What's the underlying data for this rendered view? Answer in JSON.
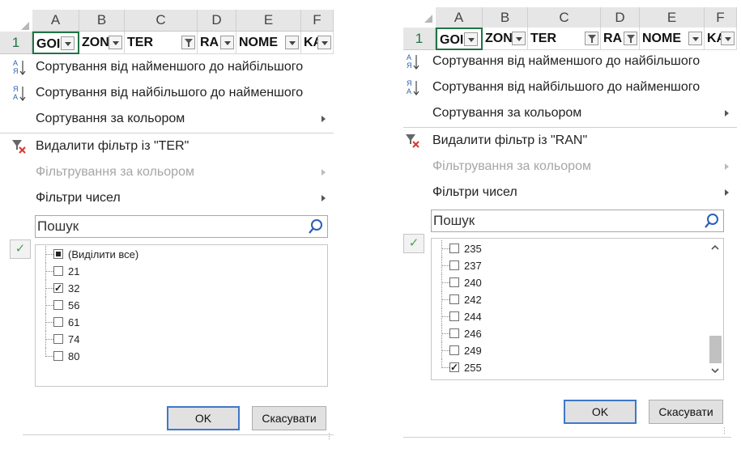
{
  "left": {
    "columns": [
      "A",
      "B",
      "C",
      "D",
      "E",
      "F"
    ],
    "row_number": "1",
    "header_cells": [
      "GOI",
      "ZON",
      "TER",
      "RA",
      "NOME",
      "KA"
    ],
    "menu": {
      "sort_asc": "Сортування від найменшого до найбільшого",
      "sort_desc": "Сортування від найбільшого до найменшого",
      "sort_color": "Сортування за кольором",
      "clear_filter": "Видалити фільтр із \"TER\"",
      "filter_color": "Фільтрування за кольором",
      "number_filters": "Фільтри чисел"
    },
    "search_placeholder": "Пошук",
    "items": [
      {
        "label": "(Виділити все)",
        "state": "partial"
      },
      {
        "label": "21",
        "state": "unchecked"
      },
      {
        "label": "32",
        "state": "checked"
      },
      {
        "label": "56",
        "state": "unchecked"
      },
      {
        "label": "61",
        "state": "unchecked"
      },
      {
        "label": "74",
        "state": "unchecked"
      },
      {
        "label": "80",
        "state": "unchecked"
      }
    ],
    "ok_label": "OK",
    "cancel_label": "Скасувати"
  },
  "right": {
    "columns": [
      "A",
      "B",
      "C",
      "D",
      "E",
      "F"
    ],
    "row_number": "1",
    "header_cells": [
      "GOI",
      "ZON",
      "TER",
      "RA",
      "NOME",
      "KA"
    ],
    "menu": {
      "sort_asc": "Сортування від найменшого до найбільшого",
      "sort_desc": "Сортування від найбільшого до найменшого",
      "sort_color": "Сортування за кольором",
      "clear_filter": "Видалити фільтр із \"RAN\"",
      "filter_color": "Фільтрування за кольором",
      "number_filters": "Фільтри чисел"
    },
    "search_placeholder": "Пошук",
    "items": [
      {
        "label": "235",
        "state": "unchecked"
      },
      {
        "label": "237",
        "state": "unchecked"
      },
      {
        "label": "240",
        "state": "unchecked"
      },
      {
        "label": "242",
        "state": "unchecked"
      },
      {
        "label": "244",
        "state": "unchecked"
      },
      {
        "label": "246",
        "state": "unchecked"
      },
      {
        "label": "249",
        "state": "unchecked"
      },
      {
        "label": "255",
        "state": "checked"
      }
    ],
    "ok_label": "OK",
    "cancel_label": "Скасувати"
  },
  "colors": {
    "accent_green": "#217346",
    "ok_border": "#3e78c8",
    "disabled_text": "#a6a6a6",
    "clear_filter_red": "#d9362b",
    "sort_blue": "#2b5fb4"
  }
}
